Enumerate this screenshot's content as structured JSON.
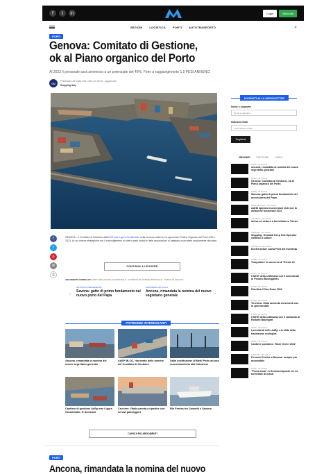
{
  "topbar": {
    "social": [
      "f",
      "t",
      "in"
    ],
    "login_label": "Login",
    "register_label": "Abbonati"
  },
  "nav": {
    "menu": [
      "SEZIONI",
      "LOGISTICA",
      "PORTI",
      "AUTOTRASPORTO"
    ]
  },
  "article": {
    "category": "PORTI",
    "title": "Genova: Comitato di Gestione, ok al Piano organico del Porto",
    "subtitle": "Al 2023 il personale sarà ammesso a un potenziale del 40%. Ferie a raggiungimento 1,9 PESI ANNUNCI",
    "author_initials": "SM",
    "meta_date": "Pubblicato 28 luglio 2021 alle ore 15:00 · Aggiornato",
    "meta_author": "Shipping Italy",
    "body_intro": "GENOVA – Il Comitato di Gestione dell'",
    "body_link": "AdSP Mar Ligure Occidentale",
    "body_rest": " nella riunione odierna, ha approvato il Piano Organico del Porto 2021-2023. Le cui misure strategiche con il coinvolgimento di tutte le parti sociali e delle associazioni di categoria sono state ampiamente discusse.",
    "continue_label": "CONTINUA A LEGGERE",
    "tags_label": "ARGOMENTI CORRELATI:",
    "tags": "ADSP MAR LIGURE OCCIDENTALE · AUTORITÀ DI SISTEMA PORTUALE · PORTO DI GENOVA"
  },
  "prevnext": {
    "prev_kicker": "ARTICOLO PRECEDENTE",
    "prev_title": "Savona: gatto di primo fondamento nel nuovo porto del Papa",
    "next_kicker": "PROSSIMO ARTICOLO",
    "next_title": "Ancona, rimandata la nomina del nuovo segretario generale"
  },
  "related": {
    "header": "POTREBBE INTERESSARTI",
    "cards": [
      {
        "title": "Ancona, rimandata la nomina del nuovo segretario generale"
      },
      {
        "title": "AdSP MLOC, rinnovato delle nomine del Comitato di Gestione"
      },
      {
        "title": "Dalla costituzione di Medi Ports ad una nuova banchina alla Calvarese"
      },
      {
        "title": "Cantiere di gestione AdSp mar Ligure Occidentale, le decisioni"
      },
      {
        "title": "Crociere: l'Italia pronta a ripartire con servizi passeggeri"
      },
      {
        "title": "Blu Ferries tra Cannetti e Savona"
      }
    ],
    "load_more": "CARICA PIÙ ARGOMENTI"
  },
  "next_article": {
    "category": "PORTI",
    "title": "Ancona, rimandata la nomina del nuovo"
  },
  "sidebar": {
    "newsletter_header": "ISCRIVITI ALLA NEWSLETTER",
    "name_label": "Nome e cognome",
    "name_placeholder": "Nome e cognome",
    "email_label": "Indirizzo email",
    "email_placeholder": "Il tuo indirizzo email",
    "register_button": "Registrati",
    "tabs": [
      "RECENTI",
      "POPOLARI",
      "VIDEO"
    ],
    "items": [
      {
        "cat": "PORTI · 28 LUGLIO",
        "title": "Ancona, rimandata la nomina del nuovo segretario generale"
      },
      {
        "cat": "PORTI · 28 LUGLIO",
        "title": "Genova: Comitato di Gestione, ok al Piano organico del Porto"
      },
      {
        "cat": "PORTI · 28 LUGLIO",
        "title": "Savona: gatto di primo fondamento del nuovo porto del Papa"
      },
      {
        "cat": "SHIPPING ITALIA · 28 LUGLIO",
        "title": "Adetti approva nuovo tassi visti con la dotazione funzionale 2022"
      },
      {
        "cat": "LOGISTICA · 28 LUGLIO",
        "title": "Arriva un vettore a tonnellata su Trieste"
      },
      {
        "cat": "SHIPPING · 28 LUGLIO",
        "title": "Shipping: Grimaldi Deep Sea Operator enfatico il settore"
      },
      {
        "cat": "LOGISTICA · 28 LUGLIO",
        "title": "Ecoferroviari: tutela Porti del Inchiesta"
      },
      {
        "cat": "PORTI · 28 LUGLIO",
        "title": "Trasportare in soccorso di Trieste 22"
      },
      {
        "cat": "PORTI · 28 LUGLIO",
        "title": "Il MITE della settimana con il commando di Perumo Boumgarten"
      },
      {
        "cat": "PORTI · 28 LUGLIO",
        "title": "Pianifica il Cao Guan 2022"
      },
      {
        "cat": "PORTI · 28 LUGLIO",
        "title": "Tirrenica: Gioia aumenta movimenti con la sperimentale"
      },
      {
        "cat": "PORTI · 28 LUGLIO",
        "title": "Il MITE della settimana con il comando di Rodolfo Baumgart"
      },
      {
        "cat": "PORTI · 28 LUGLIO",
        "title": "I presidenti delle AdSp e la sfida della transizione ecologica"
      },
      {
        "cat": "PORTI · 28 LUGLIO",
        "title": "Cantiere operativo: 'More Green 2022'"
      },
      {
        "cat": "SHIPPING · 28 LUGLIO",
        "title": "Ferrovie Exeline a Savona: sempre più accessibile"
      },
      {
        "cat": "PORTI · 28 LUGLIO",
        "title": "\"Prima cosa\": a Genova risposte rec 22 tonnellate di manzi"
      }
    ]
  }
}
